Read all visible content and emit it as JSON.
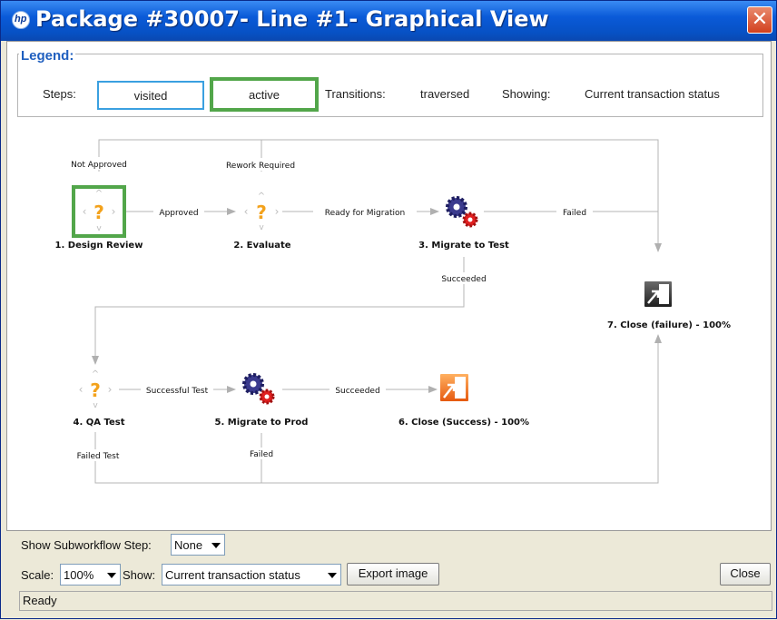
{
  "window": {
    "title": "Package #30007- Line #1- Graphical View",
    "app_icon": "hp-logo-icon"
  },
  "legend": {
    "title": "Legend:",
    "steps_label": "Steps:",
    "visited_label": "visited",
    "active_label": "active",
    "transitions_label": "Transitions:",
    "traversed_label": "traversed",
    "showing_label": "Showing:",
    "showing_value": "Current transaction status",
    "colors": {
      "visited": "#3aa0e0",
      "active": "#52a64a",
      "edge": "#b0b0b0"
    }
  },
  "workflow": {
    "nodes": [
      {
        "label": "1. Design Review",
        "icon": "question-icon",
        "active": true
      },
      {
        "label": "2. Evaluate",
        "icon": "question-icon",
        "active": false
      },
      {
        "label": "3. Migrate to Test",
        "icon": "gears-icon",
        "active": false
      },
      {
        "label": "7. Close (failure) - 100%",
        "icon": "close-exit-dark-icon",
        "active": false
      },
      {
        "label": "4. QA Test",
        "icon": "question-icon",
        "active": false
      },
      {
        "label": "5. Migrate to Prod",
        "icon": "gears-icon",
        "active": false
      },
      {
        "label": "6. Close (Success) - 100%",
        "icon": "close-exit-orange-icon",
        "active": false
      }
    ],
    "edge_labels": {
      "not_approved": "Not Approved",
      "rework_required": "Rework Required",
      "approved": "Approved",
      "ready_for_migration": "Ready for Migration",
      "failed_top": "Failed",
      "succeeded_mid": "Succeeded",
      "successful_test": "Successful Test",
      "succeeded_bottom": "Succeeded",
      "failed_test": "Failed Test",
      "failed_bottom": "Failed"
    }
  },
  "controls": {
    "subworkflow_label": "Show Subworkflow Step:",
    "subworkflow_value": "None",
    "scale_label": "Scale:",
    "scale_value": "100%",
    "show_label": "Show:",
    "show_value": "Current transaction status",
    "export_button": "Export image",
    "close_button": "Close"
  },
  "status_bar": {
    "text": "Ready"
  }
}
